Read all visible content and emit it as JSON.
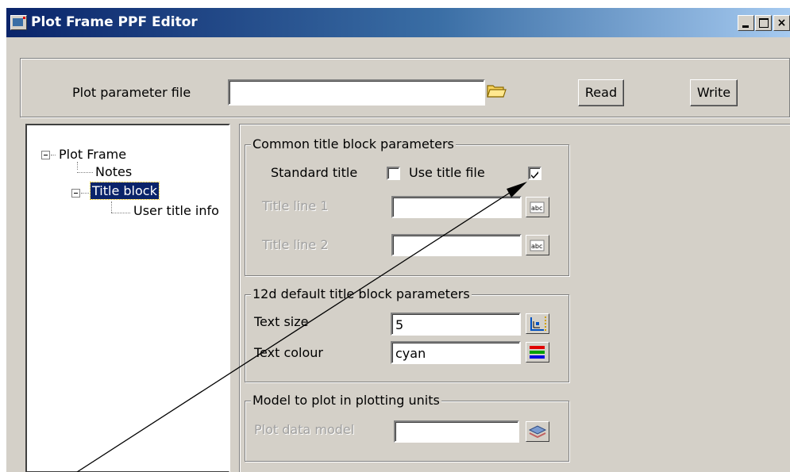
{
  "window": {
    "title": "Plot Frame PPF Editor"
  },
  "top": {
    "file_label": "Plot parameter file",
    "file_value": "",
    "read_label": "Read",
    "write_label": "Write"
  },
  "tree": {
    "items": [
      {
        "label": "Plot Frame"
      },
      {
        "label": "Notes"
      },
      {
        "label": "Title block"
      },
      {
        "label": "User title info"
      }
    ]
  },
  "common": {
    "legend": "Common title block parameters",
    "standard_title_label": "Standard title",
    "standard_title_checked": false,
    "use_title_file_label": "Use title file",
    "use_title_file_checked": true,
    "title_line_1_label": "Title line 1",
    "title_line_1_value": "",
    "title_line_2_label": "Title line 2",
    "title_line_2_value": ""
  },
  "defaults": {
    "legend": "12d default title block parameters",
    "text_size_label": "Text size",
    "text_size_value": "5",
    "text_colour_label": "Text colour",
    "text_colour_value": "cyan"
  },
  "model": {
    "legend": "Model to plot in plotting units",
    "plot_data_model_label": "Plot data model",
    "plot_data_model_value": ""
  },
  "icons": {
    "text_edit": "abc",
    "colours": [
      "#e00000",
      "#00a000",
      "#0000e0"
    ]
  }
}
